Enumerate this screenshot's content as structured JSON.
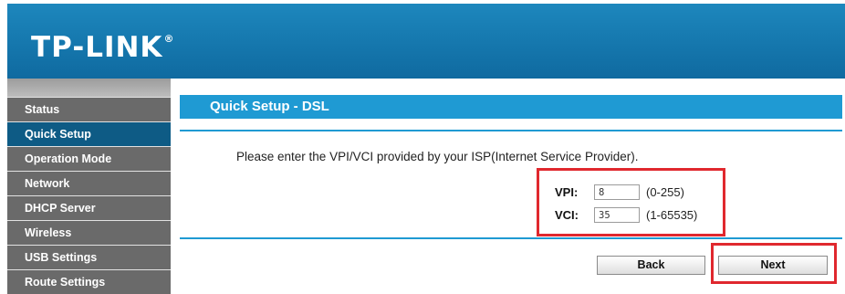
{
  "header": {
    "brand": "TP-LINK",
    "brand_mark": "®"
  },
  "sidebar": {
    "items": [
      {
        "label": "Status"
      },
      {
        "label": "Quick Setup"
      },
      {
        "label": "Operation Mode"
      },
      {
        "label": "Network"
      },
      {
        "label": "DHCP Server"
      },
      {
        "label": "Wireless"
      },
      {
        "label": "USB Settings"
      },
      {
        "label": "Route Settings"
      }
    ],
    "active_index": 1
  },
  "main": {
    "title": "Quick Setup - DSL",
    "instruction": "Please enter the VPI/VCI provided by your ISP(Internet Service Provider).",
    "vpi": {
      "label": "VPI:",
      "value": "8",
      "range": "(0-255)"
    },
    "vci": {
      "label": "VCI:",
      "value": "35",
      "range": "(1-65535)"
    },
    "back_label": "Back",
    "next_label": "Next"
  },
  "colors": {
    "header_blue": "#1377b0",
    "title_blue": "#1f9ad3",
    "nav_gray": "#6a6a6a",
    "nav_active": "#0e5b85",
    "highlight_red": "#e0282e"
  }
}
